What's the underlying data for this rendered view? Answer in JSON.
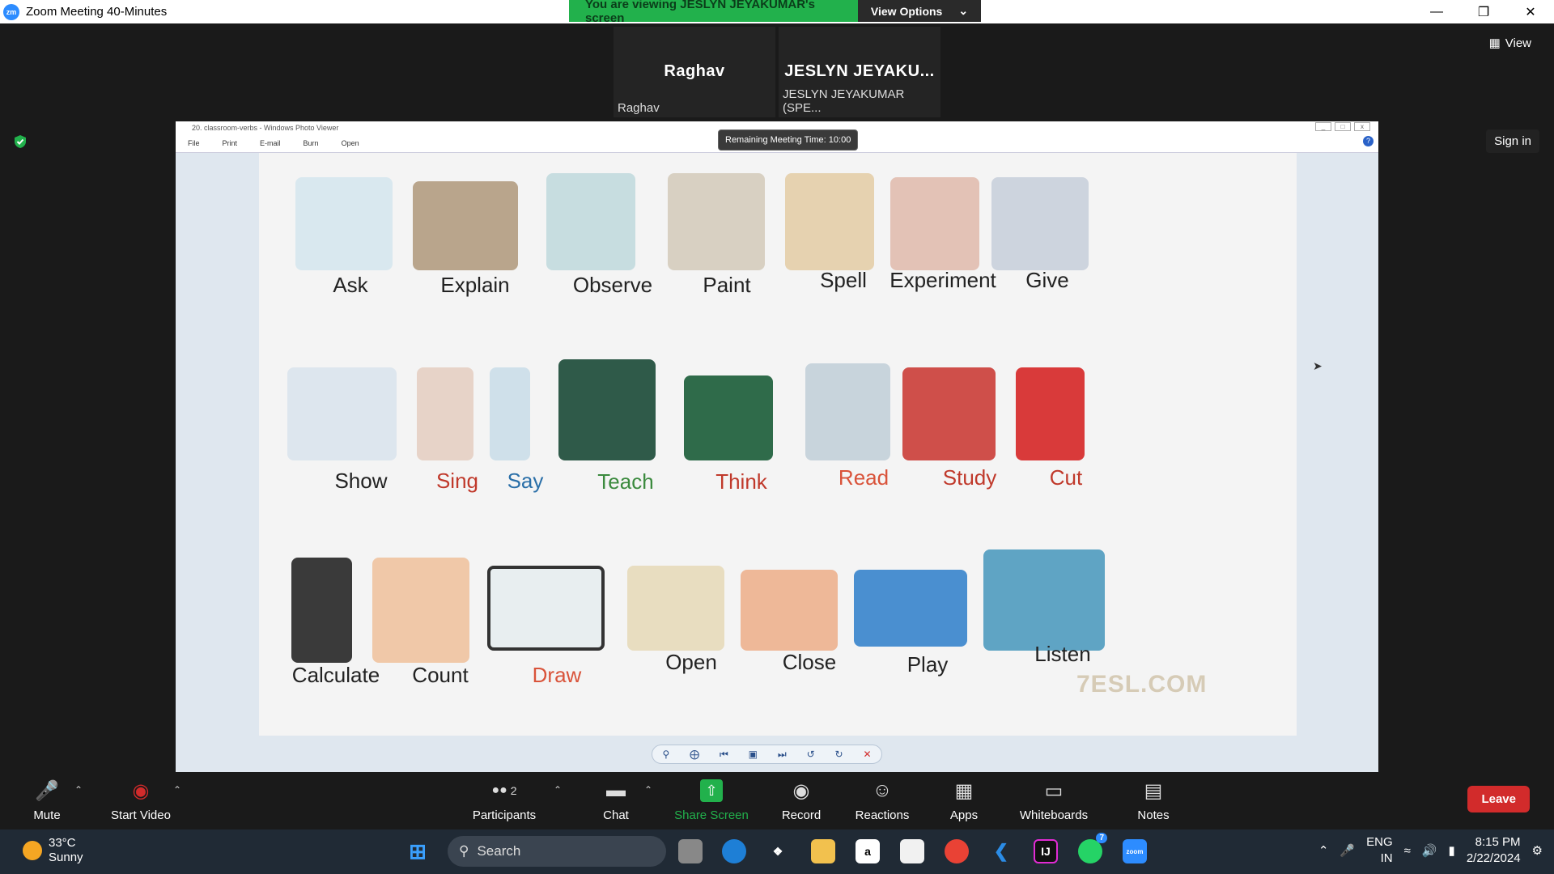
{
  "window": {
    "title": "Zoom Meeting 40-Minutes",
    "logo": "zm"
  },
  "banner": {
    "viewing": "You are viewing JESLYN JEYAKUMAR's screen",
    "view_options": "View Options"
  },
  "participants_strip": [
    {
      "name": "Raghav",
      "label": "Raghav"
    },
    {
      "name": "JESLYN  JEYAKU...",
      "label": "JESLYN JEYAKUMAR (SPE..."
    }
  ],
  "view_button": "View",
  "sign_in": "Sign in",
  "photo_viewer": {
    "title": "20. classroom-verbs - Windows Photo Viewer",
    "menu": [
      "File",
      "Print",
      "E-mail",
      "Burn",
      "Open"
    ],
    "remaining_time": "Remaining Meeting Time: 10:00",
    "watermark": "7ESL.COM"
  },
  "verbs": [
    {
      "text": "Ask",
      "color": "#222222"
    },
    {
      "text": "Explain",
      "color": "#222222"
    },
    {
      "text": "Observe",
      "color": "#222222"
    },
    {
      "text": "Paint",
      "color": "#222222"
    },
    {
      "text": "Spell",
      "color": "#222222"
    },
    {
      "text": "Experiment",
      "color": "#222222"
    },
    {
      "text": "Give",
      "color": "#222222"
    },
    {
      "text": "Show",
      "color": "#222222"
    },
    {
      "text": "Sing",
      "color": "#c0392b"
    },
    {
      "text": "Say",
      "color": "#2a6fa8"
    },
    {
      "text": "Teach",
      "color": "#3b8a3e"
    },
    {
      "text": "Think",
      "color": "#c0392b"
    },
    {
      "text": "Read",
      "color": "#d9533a"
    },
    {
      "text": "Study",
      "color": "#c0392b"
    },
    {
      "text": "Cut",
      "color": "#c0392b"
    },
    {
      "text": "Calculate",
      "color": "#222222"
    },
    {
      "text": "Count",
      "color": "#222222"
    },
    {
      "text": "Draw",
      "color": "#d9533a"
    },
    {
      "text": "Open",
      "color": "#222222"
    },
    {
      "text": "Close",
      "color": "#222222"
    },
    {
      "text": "Play",
      "color": "#222222"
    },
    {
      "text": "Listen",
      "color": "#222222"
    }
  ],
  "toolbar": {
    "mute": "Mute",
    "start_video": "Start Video",
    "participants": "Participants",
    "participants_count": "2",
    "chat": "Chat",
    "share_screen": "Share Screen",
    "record": "Record",
    "reactions": "Reactions",
    "apps": "Apps",
    "whiteboards": "Whiteboards",
    "notes": "Notes",
    "leave": "Leave"
  },
  "taskbar": {
    "temp": "33°C",
    "weather": "Sunny",
    "search": "Search",
    "whatsapp_badge": "7",
    "lang1": "ENG",
    "lang2": "IN",
    "time": "8:15 PM",
    "date": "2/22/2024"
  },
  "colors": {
    "zoom_blue": "#2d8cff",
    "share_green": "#22b14c",
    "leave_red": "#d22b2b"
  }
}
